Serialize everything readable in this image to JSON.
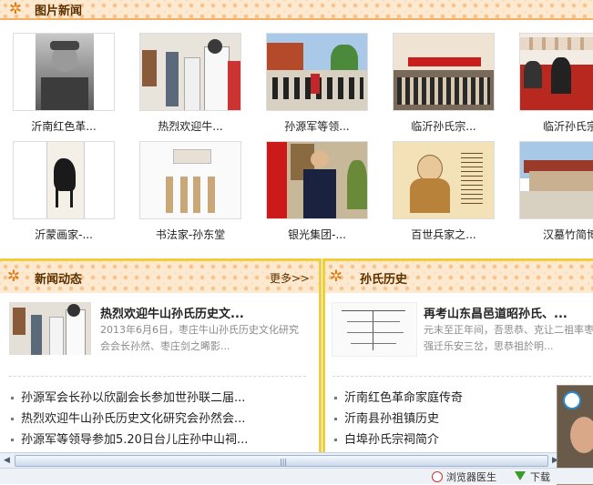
{
  "top_header": {
    "title": "图片新闻"
  },
  "photos_row1": [
    {
      "caption": "沂南红色革..."
    },
    {
      "caption": "热烈欢迎牛..."
    },
    {
      "caption": "孙源军等领..."
    },
    {
      "caption": "临沂孙氏宗..."
    },
    {
      "caption": "临沂孙氏宗"
    }
  ],
  "photos_row2": [
    {
      "caption": "沂蒙画家-..."
    },
    {
      "caption": "书法家-孙东堂"
    },
    {
      "caption": "银光集团-..."
    },
    {
      "caption": "百世兵家之..."
    },
    {
      "caption": "汉墓竹简博"
    }
  ],
  "news_panel": {
    "title": "新闻动态",
    "more": "更多>>",
    "featured_title": "热烈欢迎牛山孙氏历史文...",
    "featured_desc": "2013年6月6日，枣庄牛山孙氏历史文化研究会会长孙然、枣庄剑之晞影...",
    "items": [
      "孙源军会长孙以欣副会长参加世孙联二届...",
      "热烈欢迎牛山孙氏历史文化研究会孙然会...",
      "孙源军等领导参加5.20日台儿庄孙中山祠..."
    ]
  },
  "history_panel": {
    "title": "孙氏历史",
    "featured_title": "再考山东昌邑道昭孙氏、...",
    "featured_desc": "元末至正年间，吾思恭、克让二祖率枣强迁乐安三岔，思恭祖於明...",
    "items": [
      "沂南红色革命家庭传奇",
      "沂南县孙祖镇历史",
      "白埠孙氏宗祠简介"
    ]
  },
  "scrollbar": {
    "left_arrow": "◀",
    "right_arrow": "▶",
    "grip": "|||"
  },
  "statusbar": {
    "doctor": "浏览器医生",
    "download": "下载"
  },
  "icons": {
    "header_icon": "✲"
  },
  "colors": {
    "accent_orange": "#e07a10",
    "panel_border": "#f1cf3a",
    "header_bg": "#fde9cf"
  }
}
